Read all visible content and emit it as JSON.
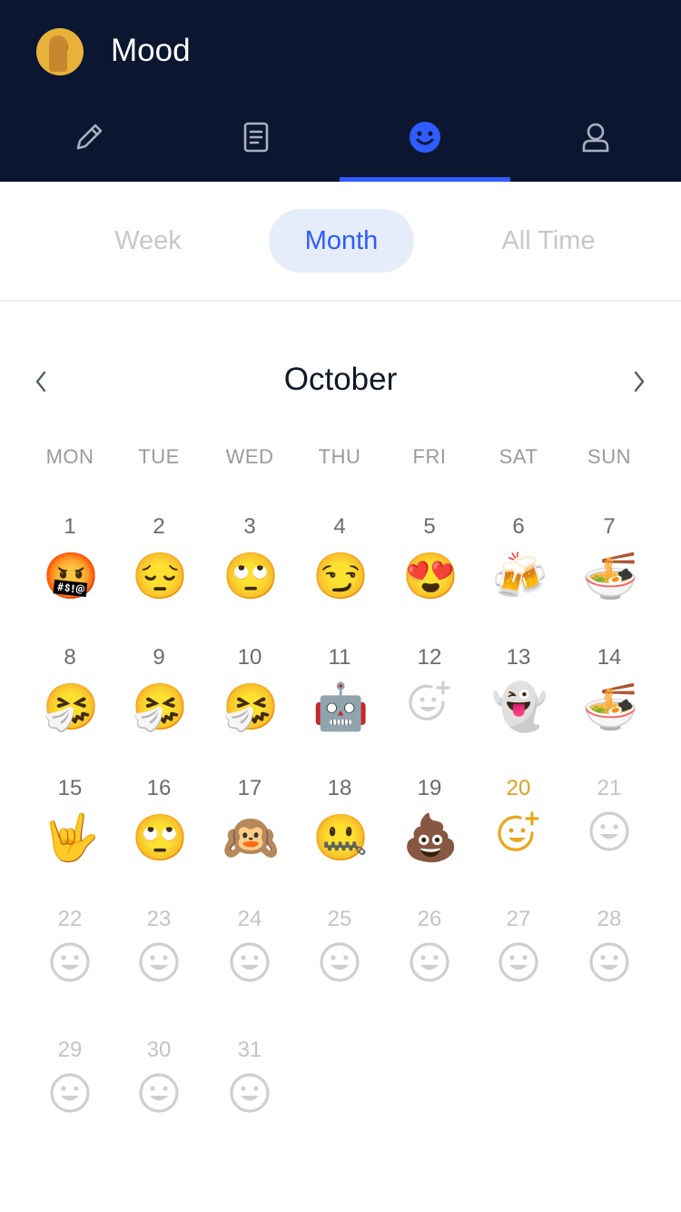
{
  "app": {
    "title": "Mood"
  },
  "tabs": [
    {
      "name": "write",
      "icon": "pencil-icon"
    },
    {
      "name": "notes",
      "icon": "document-icon"
    },
    {
      "name": "mood",
      "icon": "smiley-icon",
      "active": true
    },
    {
      "name": "profile",
      "icon": "user-icon"
    }
  ],
  "segments": {
    "week": "Week",
    "month": "Month",
    "all_time": "All Time",
    "selected": "Month"
  },
  "calendar": {
    "month": "October",
    "weekdays": [
      "MON",
      "TUE",
      "WED",
      "THU",
      "FRI",
      "SAT",
      "SUN"
    ],
    "today": 20,
    "days": [
      {
        "n": "1",
        "mood": "🤬"
      },
      {
        "n": "2",
        "mood": "😔"
      },
      {
        "n": "3",
        "mood": "🙄"
      },
      {
        "n": "4",
        "mood": "😏"
      },
      {
        "n": "5",
        "mood": "😍"
      },
      {
        "n": "6",
        "mood": "🍻"
      },
      {
        "n": "7",
        "mood": "🍜"
      },
      {
        "n": "8",
        "mood": "🤧"
      },
      {
        "n": "9",
        "mood": "🤧"
      },
      {
        "n": "10",
        "mood": "🤧"
      },
      {
        "n": "11",
        "mood": "🤖"
      },
      {
        "n": "12",
        "mood": "add-mood-icon"
      },
      {
        "n": "13",
        "mood": "👻"
      },
      {
        "n": "14",
        "mood": "🍜"
      },
      {
        "n": "15",
        "mood": "🤟"
      },
      {
        "n": "16",
        "mood": "🙄"
      },
      {
        "n": "17",
        "mood": "🙉"
      },
      {
        "n": "18",
        "mood": "🤐"
      },
      {
        "n": "19",
        "mood": "💩"
      },
      {
        "n": "20",
        "mood": "add-mood-icon-today"
      },
      {
        "n": "21",
        "mood": "empty-smiley-icon"
      },
      {
        "n": "22",
        "mood": "empty-smiley-icon"
      },
      {
        "n": "23",
        "mood": "empty-smiley-icon"
      },
      {
        "n": "24",
        "mood": "empty-smiley-icon"
      },
      {
        "n": "25",
        "mood": "empty-smiley-icon"
      },
      {
        "n": "26",
        "mood": "empty-smiley-icon"
      },
      {
        "n": "27",
        "mood": "empty-smiley-icon"
      },
      {
        "n": "28",
        "mood": "empty-smiley-icon"
      },
      {
        "n": "29",
        "mood": "empty-smiley-icon"
      },
      {
        "n": "30",
        "mood": "empty-smiley-icon"
      },
      {
        "n": "31",
        "mood": "empty-smiley-icon"
      }
    ]
  },
  "colors": {
    "header_bg": "#0b1730",
    "accent": "#2f5bff",
    "today": "#e0a020",
    "muted": "#c4c4c8"
  }
}
